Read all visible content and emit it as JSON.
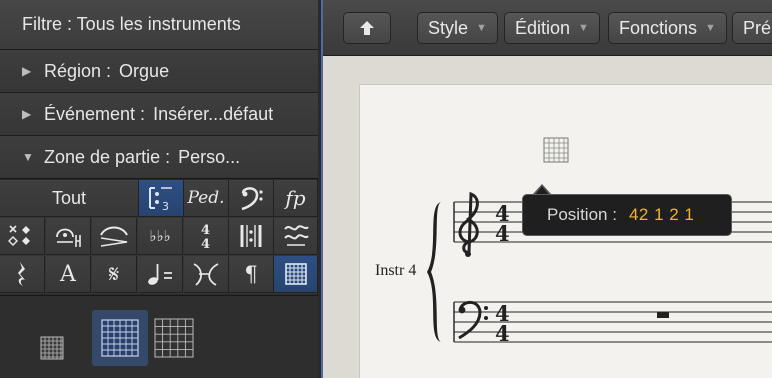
{
  "inspector": {
    "filter_label": "Filtre : Tous les instruments",
    "region": {
      "label": "Région :",
      "value": "Orgue"
    },
    "event": {
      "label": "Événement :",
      "value": "Insérer...défaut"
    },
    "part_box": {
      "label": "Zone de partie :",
      "value": "Perso..."
    },
    "palette": {
      "tout_label": "Tout",
      "pedal_text": "Ped.",
      "dynamic_text": "fp",
      "text_glyph": "A",
      "paragraph_glyph": "¶",
      "selected_icon": "chord-grid-icon"
    }
  },
  "toolbar": {
    "up_icon": "arrow-up-icon",
    "menus": [
      {
        "label": "Style"
      },
      {
        "label": "Édition"
      },
      {
        "label": "Fonctions"
      },
      {
        "label": "Pré"
      }
    ]
  },
  "score": {
    "instrument_label": "Instr 4",
    "time_signature_top": "4",
    "time_signature_bottom": "4"
  },
  "tooltip": {
    "label": "Position :",
    "value": "42 1 2 1"
  },
  "colors": {
    "accent_blue": "#2e4f85",
    "position_value": "#f0b42c",
    "paper": "#f3f2ee"
  }
}
